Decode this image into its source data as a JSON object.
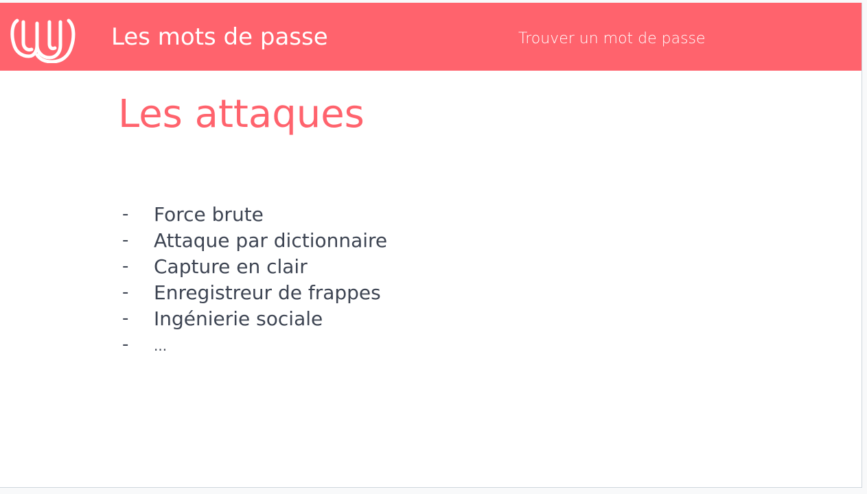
{
  "header": {
    "title": "Les mots de passe",
    "nav_link": "Trouver un mot de passe",
    "logo_icon": "wavy-lines-logo-icon",
    "background_color": "#ff636d"
  },
  "main": {
    "title": "Les attaques",
    "title_color": "#ff636d",
    "bullet": "-",
    "items": [
      "Force brute",
      "Attaque par dictionnaire",
      "Capture en clair",
      "Enregistreur de frappes",
      "Ingénierie sociale",
      "..."
    ]
  }
}
